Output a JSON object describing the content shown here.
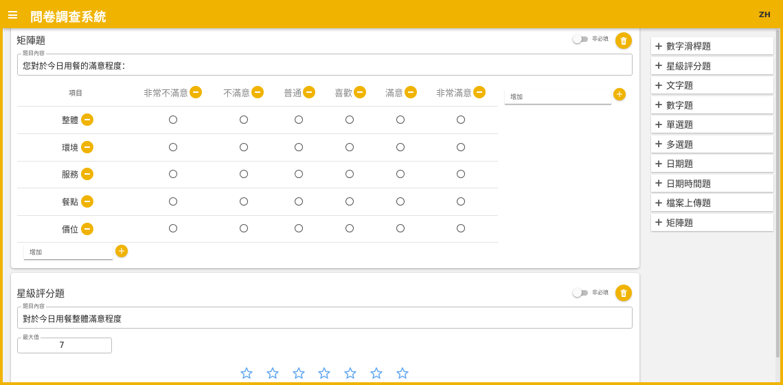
{
  "app": {
    "title": "問卷調查系統",
    "lang": "ZH"
  },
  "matrix": {
    "title": "矩陣題",
    "required_label": "非必填",
    "question_legend": "題目內容",
    "question_text": "您對於今日用餐的滿意程度：",
    "first_col": "項目",
    "columns": [
      "非常不滿意",
      "不滿意",
      "普通",
      "喜歡",
      "滿意",
      "非常滿意"
    ],
    "rows": [
      "整體",
      "環境",
      "服務",
      "餐點",
      "價位"
    ],
    "add_column_placeholder": "增加",
    "add_row_placeholder": "增加"
  },
  "star": {
    "title": "星級評分題",
    "required_label": "非必填",
    "question_legend": "題目內容",
    "question_text": "對於今日用餐整體滿意程度",
    "max_legend": "最大值",
    "max_value": "7",
    "star_count": 7
  },
  "sidebar": {
    "items": [
      {
        "label": "數字滑桿題"
      },
      {
        "label": "星級評分題"
      },
      {
        "label": "文字題"
      },
      {
        "label": "數字題"
      },
      {
        "label": "單選題"
      },
      {
        "label": "多選題"
      },
      {
        "label": "日期題"
      },
      {
        "label": "日期時間題"
      },
      {
        "label": "檔案上傳題"
      },
      {
        "label": "矩陣題"
      }
    ]
  },
  "colors": {
    "accent": "#f0b300",
    "star": "#64a8f0"
  }
}
